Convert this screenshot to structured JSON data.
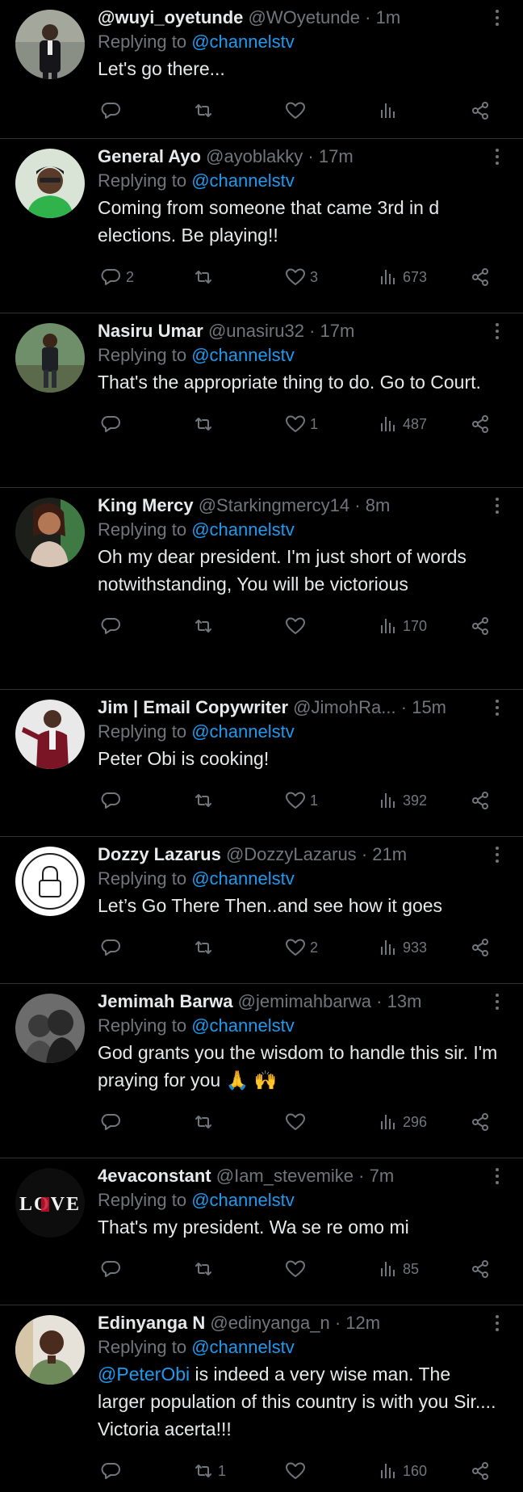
{
  "colors": {
    "background": "#000000",
    "text": "#e7e9ea",
    "muted": "#71767b",
    "link": "#1d9bf0",
    "divider": "#2f3336"
  },
  "icons": {
    "reply": "speech-bubble-icon",
    "retweet": "retweet-arrows-icon",
    "like": "heart-icon",
    "views": "bar-chart-icon",
    "share": "share-nodes-icon",
    "more": "vertical-ellipsis-icon"
  },
  "tweets": [
    {
      "name": "@wuyi_oyetunde",
      "handle": "@WOyetunde",
      "dot": "·",
      "time": "1m",
      "replying_prefix": "Replying to ",
      "replying_to": "@channelstv",
      "text_mention": "",
      "text": "Let's go there...",
      "replies": "",
      "retweets": "",
      "likes": "",
      "views": ""
    },
    {
      "name": "General Ayo",
      "handle": "@ayoblakky",
      "dot": "·",
      "time": "17m",
      "replying_prefix": "Replying to ",
      "replying_to": "@channelstv",
      "text_mention": "",
      "text": "Coming from someone that came 3rd in d elections. Be playing!!",
      "replies": "2",
      "retweets": "",
      "likes": "3",
      "views": "673"
    },
    {
      "name": "Nasiru Umar",
      "handle": "@unasiru32",
      "dot": "·",
      "time": "17m",
      "replying_prefix": "Replying to ",
      "replying_to": "@channelstv",
      "text_mention": "",
      "text": "That's the appropriate thing to do. Go to Court.",
      "replies": "",
      "retweets": "",
      "likes": "1",
      "views": "487"
    },
    {
      "name": "King Mercy",
      "handle": "@Starkingmercy14",
      "dot": "·",
      "time": "8m",
      "replying_prefix": "Replying to ",
      "replying_to": "@channelstv",
      "text_mention": "",
      "text": "Oh my dear president. I'm just short of words notwithstanding, You will be victorious",
      "replies": "",
      "retweets": "",
      "likes": "",
      "views": "170"
    },
    {
      "name": "Jim | Email Copywriter",
      "handle": "@JimohRa...",
      "dot": "·",
      "time": "15m",
      "replying_prefix": "Replying to ",
      "replying_to": "@channelstv",
      "text_mention": "",
      "text": "Peter Obi is cooking!",
      "replies": "",
      "retweets": "",
      "likes": "1",
      "views": "392"
    },
    {
      "name": "Dozzy Lazarus",
      "handle": "@DozzyLazarus",
      "dot": "·",
      "time": "21m",
      "replying_prefix": "Replying to ",
      "replying_to": "@channelstv",
      "text_mention": "",
      "text": "Let’s Go There Then..and see how it goes",
      "replies": "",
      "retweets": "",
      "likes": "2",
      "views": "933"
    },
    {
      "name": "Jemimah Barwa",
      "handle": "@jemimahbarwa",
      "dot": "·",
      "time": "13m",
      "replying_prefix": "Replying to ",
      "replying_to": "@channelstv",
      "text_mention": "",
      "text": "God grants you the wisdom to handle this sir. I'm praying for you 🙏 🙌",
      "replies": "",
      "retweets": "",
      "likes": "",
      "views": "296"
    },
    {
      "name": "4evaconstant",
      "handle": "@Iam_stevemike",
      "dot": "·",
      "time": "7m",
      "replying_prefix": "Replying to ",
      "replying_to": "@channelstv",
      "text_mention": "",
      "text": "That's my president. Wa se re omo mi",
      "replies": "",
      "retweets": "",
      "likes": "",
      "views": "85"
    },
    {
      "name": "Edinyanga N",
      "handle": "@edinyanga_n",
      "dot": "·",
      "time": "12m",
      "replying_prefix": "Replying to ",
      "replying_to": "@channelstv",
      "text_mention": "@PeterObi",
      "text": " is indeed a very wise man. The larger population of this country is with you Sir.... Victoria acerta!!!",
      "replies": "",
      "retweets": "1",
      "likes": "",
      "views": "160"
    }
  ],
  "avatar_texts": {
    "love_badge": "LOVE"
  }
}
